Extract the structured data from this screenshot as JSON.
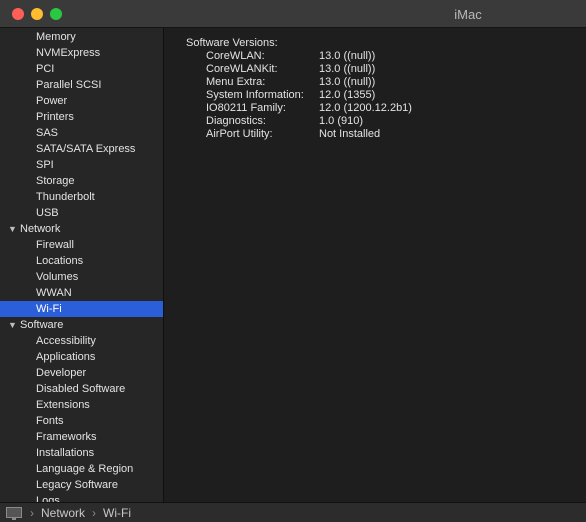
{
  "window": {
    "title": "iMac"
  },
  "sidebar": {
    "items": [
      {
        "label": "Memory",
        "level": 2
      },
      {
        "label": "NVMExpress",
        "level": 2
      },
      {
        "label": "PCI",
        "level": 2
      },
      {
        "label": "Parallel SCSI",
        "level": 2
      },
      {
        "label": "Power",
        "level": 2
      },
      {
        "label": "Printers",
        "level": 2
      },
      {
        "label": "SAS",
        "level": 2
      },
      {
        "label": "SATA/SATA Express",
        "level": 2
      },
      {
        "label": "SPI",
        "level": 2
      },
      {
        "label": "Storage",
        "level": 2
      },
      {
        "label": "Thunderbolt",
        "level": 2
      },
      {
        "label": "USB",
        "level": 2
      },
      {
        "label": "Network",
        "level": 1
      },
      {
        "label": "Firewall",
        "level": 2
      },
      {
        "label": "Locations",
        "level": 2
      },
      {
        "label": "Volumes",
        "level": 2
      },
      {
        "label": "WWAN",
        "level": 2
      },
      {
        "label": "Wi-Fi",
        "level": 2,
        "selected": true
      },
      {
        "label": "Software",
        "level": 1
      },
      {
        "label": "Accessibility",
        "level": 2
      },
      {
        "label": "Applications",
        "level": 2
      },
      {
        "label": "Developer",
        "level": 2
      },
      {
        "label": "Disabled Software",
        "level": 2
      },
      {
        "label": "Extensions",
        "level": 2
      },
      {
        "label": "Fonts",
        "level": 2
      },
      {
        "label": "Frameworks",
        "level": 2
      },
      {
        "label": "Installations",
        "level": 2
      },
      {
        "label": "Language & Region",
        "level": 2
      },
      {
        "label": "Legacy Software",
        "level": 2
      },
      {
        "label": "Logs",
        "level": 2
      }
    ]
  },
  "content": {
    "heading": "Software Versions:",
    "rows": [
      {
        "key": "CoreWLAN:",
        "value": "13.0 ((null))"
      },
      {
        "key": "CoreWLANKit:",
        "value": "13.0 ((null))"
      },
      {
        "key": "Menu Extra:",
        "value": "13.0 ((null))"
      },
      {
        "key": "System Information:",
        "value": "12.0 (1355)"
      },
      {
        "key": "IO80211 Family:",
        "value": "12.0 (1200.12.2b1)"
      },
      {
        "key": "Diagnostics:",
        "value": "1.0 (910)"
      },
      {
        "key": "AirPort Utility:",
        "value": "Not Installed"
      }
    ]
  },
  "statusbar": {
    "separator": "›",
    "crumbs": [
      "Network",
      "Wi-Fi"
    ]
  },
  "colors": {
    "selection": "#2b5fd9"
  }
}
